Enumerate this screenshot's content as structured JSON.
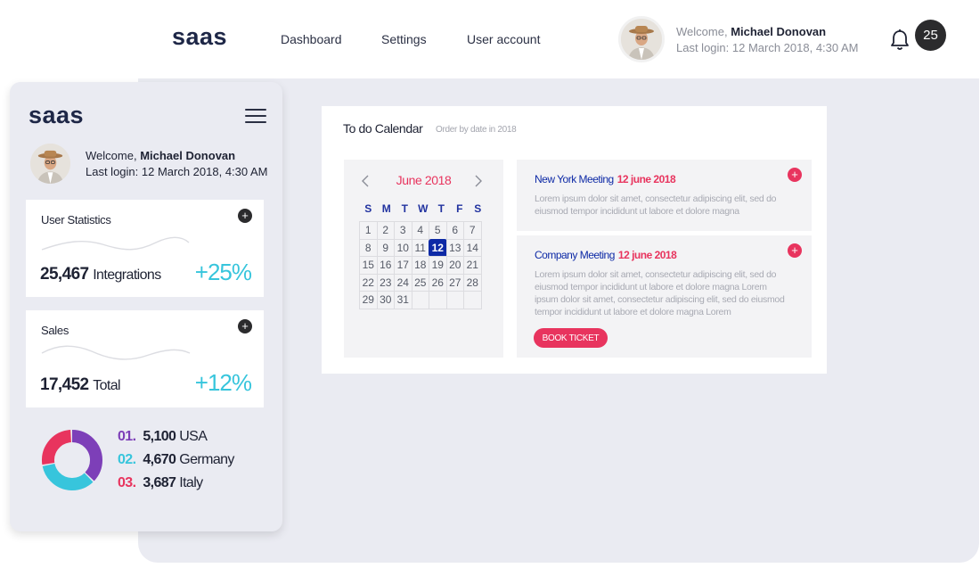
{
  "header": {
    "logo": "saas",
    "nav": [
      {
        "label": "Dashboard"
      },
      {
        "label": "Settings"
      },
      {
        "label": "User account"
      }
    ],
    "welcome_prefix": "Welcome,",
    "user_name": "Michael Donovan",
    "last_login": "Last login: 12 March 2018, 4:30 AM",
    "notification_count": "25"
  },
  "sidebar": {
    "logo": "saas",
    "welcome_prefix": "Welcome,",
    "user_name": "Michael Donovan",
    "last_login": "Last login: 12 March 2018, 4:30 AM",
    "cards": [
      {
        "title": "User Statistics",
        "value": "25,467",
        "unit": "Integrations",
        "change": "+25%"
      },
      {
        "title": "Sales",
        "value": "17,452",
        "unit": "Total",
        "change": "+12%"
      }
    ],
    "countries": [
      {
        "index": "01.",
        "value": "5,100",
        "name": "USA",
        "color": "#7d3fb8"
      },
      {
        "index": "02.",
        "value": "4,670",
        "name": "Germany",
        "color": "#37c5dc"
      },
      {
        "index": "03.",
        "value": "3,687",
        "name": "Italy",
        "color": "#e8345e"
      }
    ]
  },
  "calendar": {
    "title": "To do Calendar",
    "subtitle": "Order by date in 2018",
    "month": "June 2018",
    "weekdays": [
      "S",
      "M",
      "T",
      "W",
      "T",
      "F",
      "S"
    ],
    "weeks": [
      [
        "1",
        "2",
        "3",
        "4",
        "5",
        "6",
        "7"
      ],
      [
        "8",
        "9",
        "10",
        "11",
        "12",
        "13",
        "14"
      ],
      [
        "15",
        "16",
        "17",
        "18",
        "19",
        "20",
        "21"
      ],
      [
        "22",
        "23",
        "24",
        "25",
        "26",
        "27",
        "28"
      ],
      [
        "29",
        "30",
        "31",
        "",
        "",
        "",
        ""
      ]
    ],
    "selected_day": "12"
  },
  "events": [
    {
      "title": "New York Meeting",
      "date": "12 june 2018",
      "description": "Lorem ipsum dolor sit amet, consectetur adipiscing elit, sed do eiusmod tempor incididunt ut labore et dolore magna"
    },
    {
      "title": "Company Meeting",
      "date": "12 june 2018",
      "description": "Lorem ipsum dolor sit amet, consectetur adipiscing elit, sed do eiusmod tempor incididunt ut labore et dolore magna Lorem ipsum dolor sit amet, consectetur adipiscing elit, sed do eiusmod tempor incididunt ut labore et dolore magna Lorem",
      "button": "BOOK TICKET"
    }
  ],
  "colors": {
    "accent_pink": "#e8345e",
    "accent_blue": "#0e2aa6",
    "accent_cyan": "#37c5dc",
    "accent_purple": "#7d3fb8",
    "panel_bg": "#eaebf2"
  }
}
